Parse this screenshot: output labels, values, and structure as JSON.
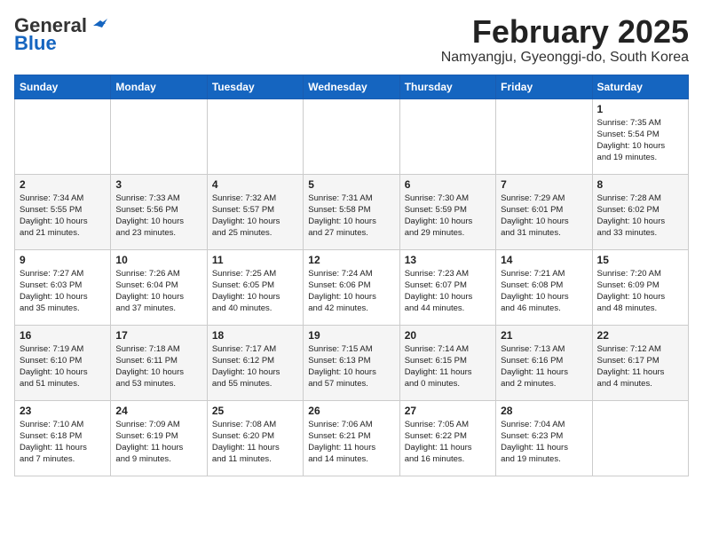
{
  "header": {
    "logo_line1": "General",
    "logo_line2": "Blue",
    "month_title": "February 2025",
    "subtitle": "Namyangju, Gyeonggi-do, South Korea"
  },
  "weekdays": [
    "Sunday",
    "Monday",
    "Tuesday",
    "Wednesday",
    "Thursday",
    "Friday",
    "Saturday"
  ],
  "weeks": [
    [
      {
        "day": "",
        "info": ""
      },
      {
        "day": "",
        "info": ""
      },
      {
        "day": "",
        "info": ""
      },
      {
        "day": "",
        "info": ""
      },
      {
        "day": "",
        "info": ""
      },
      {
        "day": "",
        "info": ""
      },
      {
        "day": "1",
        "info": "Sunrise: 7:35 AM\nSunset: 5:54 PM\nDaylight: 10 hours\nand 19 minutes."
      }
    ],
    [
      {
        "day": "2",
        "info": "Sunrise: 7:34 AM\nSunset: 5:55 PM\nDaylight: 10 hours\nand 21 minutes."
      },
      {
        "day": "3",
        "info": "Sunrise: 7:33 AM\nSunset: 5:56 PM\nDaylight: 10 hours\nand 23 minutes."
      },
      {
        "day": "4",
        "info": "Sunrise: 7:32 AM\nSunset: 5:57 PM\nDaylight: 10 hours\nand 25 minutes."
      },
      {
        "day": "5",
        "info": "Sunrise: 7:31 AM\nSunset: 5:58 PM\nDaylight: 10 hours\nand 27 minutes."
      },
      {
        "day": "6",
        "info": "Sunrise: 7:30 AM\nSunset: 5:59 PM\nDaylight: 10 hours\nand 29 minutes."
      },
      {
        "day": "7",
        "info": "Sunrise: 7:29 AM\nSunset: 6:01 PM\nDaylight: 10 hours\nand 31 minutes."
      },
      {
        "day": "8",
        "info": "Sunrise: 7:28 AM\nSunset: 6:02 PM\nDaylight: 10 hours\nand 33 minutes."
      }
    ],
    [
      {
        "day": "9",
        "info": "Sunrise: 7:27 AM\nSunset: 6:03 PM\nDaylight: 10 hours\nand 35 minutes."
      },
      {
        "day": "10",
        "info": "Sunrise: 7:26 AM\nSunset: 6:04 PM\nDaylight: 10 hours\nand 37 minutes."
      },
      {
        "day": "11",
        "info": "Sunrise: 7:25 AM\nSunset: 6:05 PM\nDaylight: 10 hours\nand 40 minutes."
      },
      {
        "day": "12",
        "info": "Sunrise: 7:24 AM\nSunset: 6:06 PM\nDaylight: 10 hours\nand 42 minutes."
      },
      {
        "day": "13",
        "info": "Sunrise: 7:23 AM\nSunset: 6:07 PM\nDaylight: 10 hours\nand 44 minutes."
      },
      {
        "day": "14",
        "info": "Sunrise: 7:21 AM\nSunset: 6:08 PM\nDaylight: 10 hours\nand 46 minutes."
      },
      {
        "day": "15",
        "info": "Sunrise: 7:20 AM\nSunset: 6:09 PM\nDaylight: 10 hours\nand 48 minutes."
      }
    ],
    [
      {
        "day": "16",
        "info": "Sunrise: 7:19 AM\nSunset: 6:10 PM\nDaylight: 10 hours\nand 51 minutes."
      },
      {
        "day": "17",
        "info": "Sunrise: 7:18 AM\nSunset: 6:11 PM\nDaylight: 10 hours\nand 53 minutes."
      },
      {
        "day": "18",
        "info": "Sunrise: 7:17 AM\nSunset: 6:12 PM\nDaylight: 10 hours\nand 55 minutes."
      },
      {
        "day": "19",
        "info": "Sunrise: 7:15 AM\nSunset: 6:13 PM\nDaylight: 10 hours\nand 57 minutes."
      },
      {
        "day": "20",
        "info": "Sunrise: 7:14 AM\nSunset: 6:15 PM\nDaylight: 11 hours\nand 0 minutes."
      },
      {
        "day": "21",
        "info": "Sunrise: 7:13 AM\nSunset: 6:16 PM\nDaylight: 11 hours\nand 2 minutes."
      },
      {
        "day": "22",
        "info": "Sunrise: 7:12 AM\nSunset: 6:17 PM\nDaylight: 11 hours\nand 4 minutes."
      }
    ],
    [
      {
        "day": "23",
        "info": "Sunrise: 7:10 AM\nSunset: 6:18 PM\nDaylight: 11 hours\nand 7 minutes."
      },
      {
        "day": "24",
        "info": "Sunrise: 7:09 AM\nSunset: 6:19 PM\nDaylight: 11 hours\nand 9 minutes."
      },
      {
        "day": "25",
        "info": "Sunrise: 7:08 AM\nSunset: 6:20 PM\nDaylight: 11 hours\nand 11 minutes."
      },
      {
        "day": "26",
        "info": "Sunrise: 7:06 AM\nSunset: 6:21 PM\nDaylight: 11 hours\nand 14 minutes."
      },
      {
        "day": "27",
        "info": "Sunrise: 7:05 AM\nSunset: 6:22 PM\nDaylight: 11 hours\nand 16 minutes."
      },
      {
        "day": "28",
        "info": "Sunrise: 7:04 AM\nSunset: 6:23 PM\nDaylight: 11 hours\nand 19 minutes."
      },
      {
        "day": "",
        "info": ""
      }
    ]
  ]
}
